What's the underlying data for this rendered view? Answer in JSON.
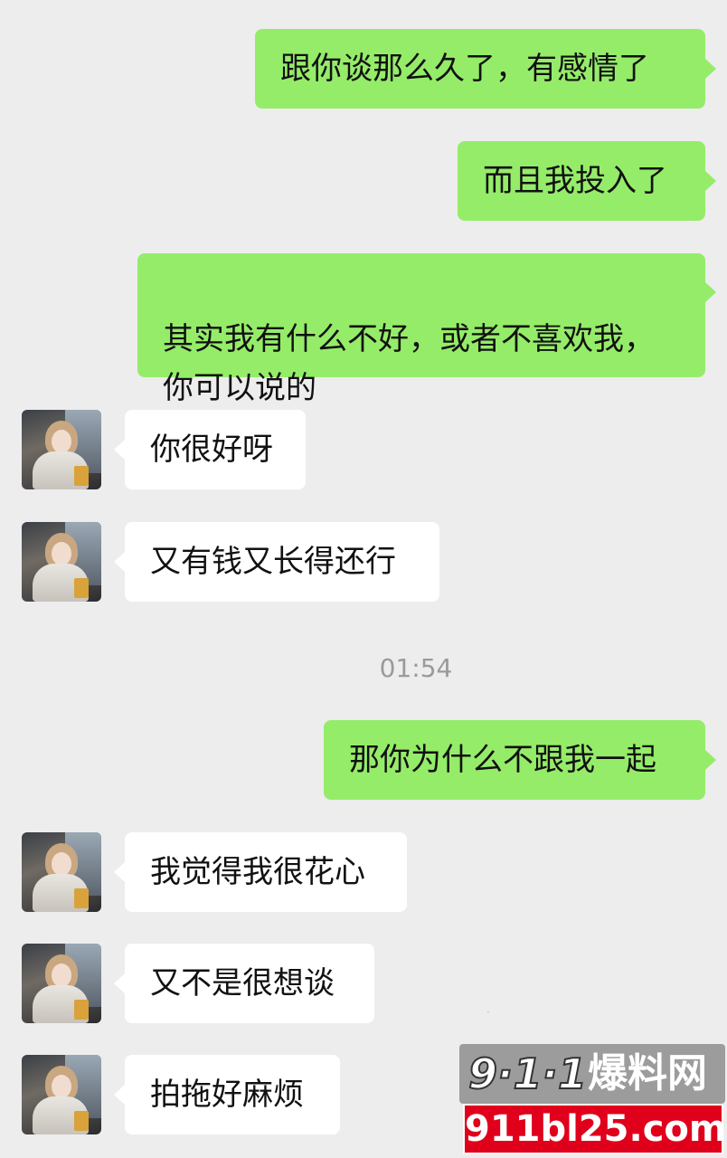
{
  "timestamp": "01:54",
  "messages": [
    {
      "side": "out",
      "text": "跟你谈那么久了，有感情了"
    },
    {
      "side": "out",
      "text": "而且我投入了"
    },
    {
      "side": "out",
      "text": "其实我有什么不好，或者不喜欢我，\n你可以说的"
    },
    {
      "side": "in",
      "text": "你很好呀"
    },
    {
      "side": "in",
      "text": "又有钱又长得还行"
    },
    {
      "side": "out",
      "text": "那你为什么不跟我一起"
    },
    {
      "side": "in",
      "text": "我觉得我很花心"
    },
    {
      "side": "in",
      "text": "又不是很想谈"
    },
    {
      "side": "in",
      "text": "拍拖好麻烦"
    }
  ],
  "watermark": {
    "logo": "9·1·1",
    "name": "爆料网",
    "domain": "911bl25.com"
  },
  "colors": {
    "background": "#ededed",
    "outgoing_bubble": "#95ec69",
    "incoming_bubble": "#ffffff",
    "watermark_red": "#e0001b"
  }
}
